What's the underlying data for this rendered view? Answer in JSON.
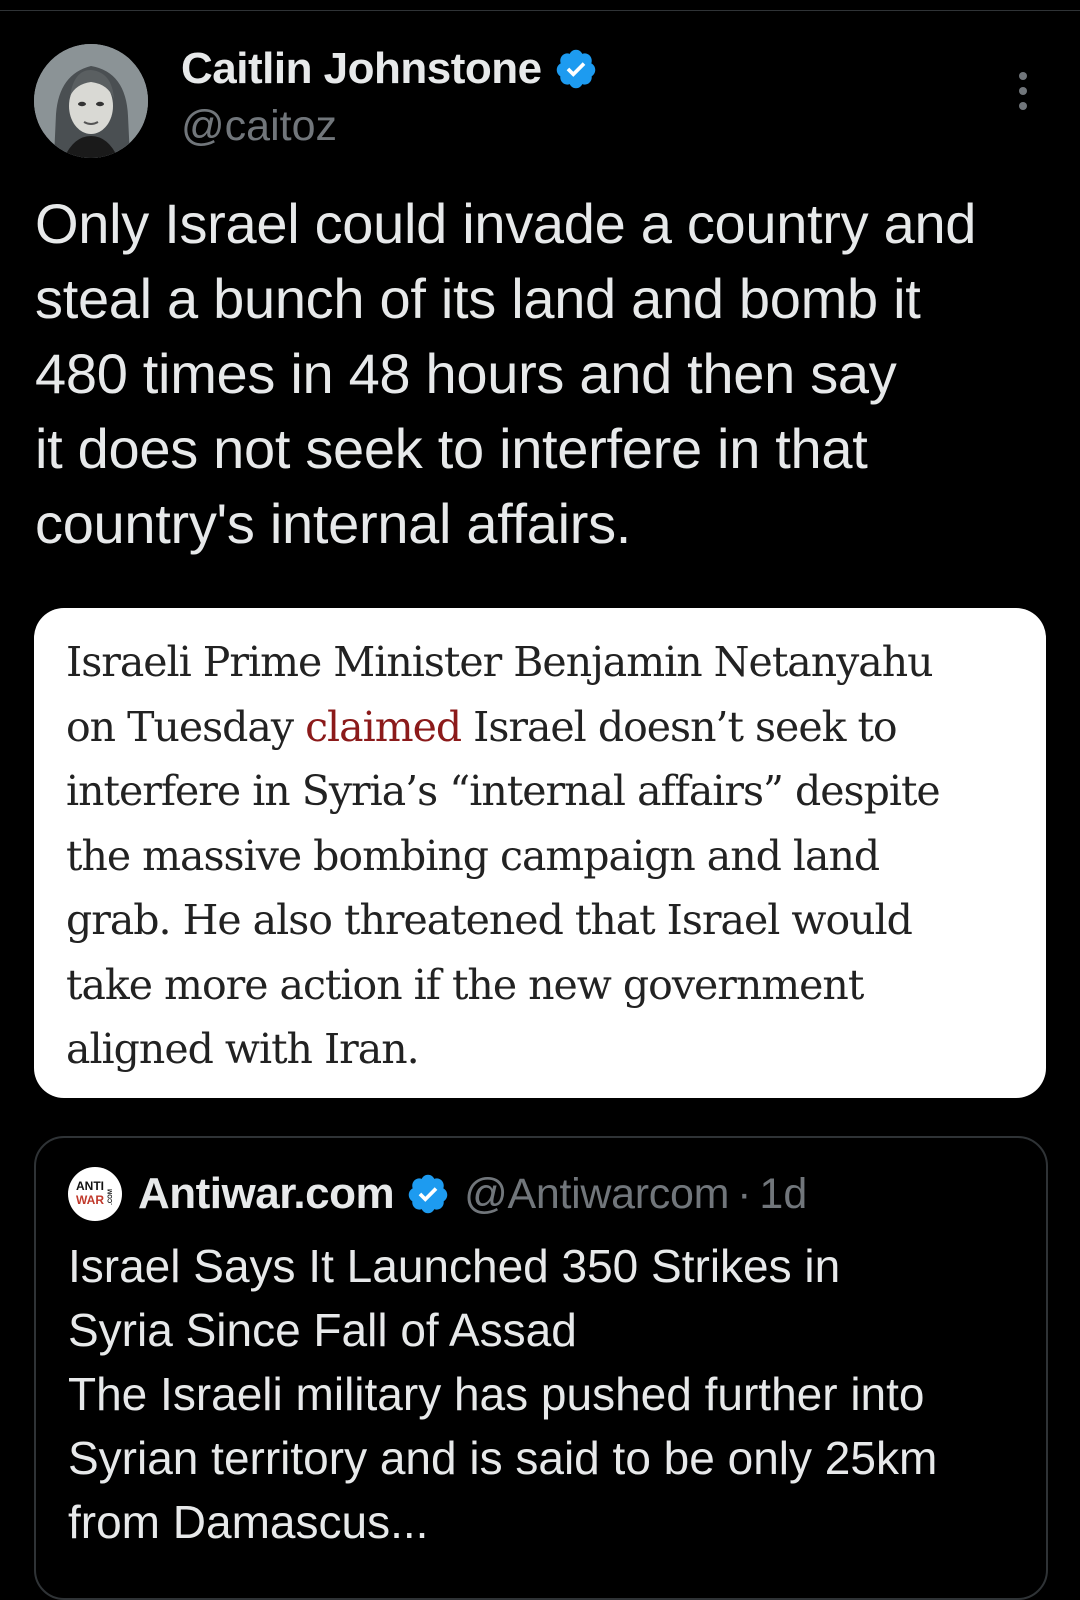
{
  "tweet": {
    "author": {
      "display_name": "Caitlin Johnstone",
      "handle": "@caitoz",
      "verified": true
    },
    "text_lines": [
      "Only Israel could invade a country and",
      "steal a bunch of its land and bomb it",
      "480 times in 48 hours and then say",
      "it does not seek to interfere in that",
      "country's internal affairs."
    ],
    "media": {
      "line1": "Israeli Prime Minister Benjamin Netanyahu",
      "line2_before": "on Tuesday ",
      "line2_link": "claimed",
      "line2_after": " Israel doesn’t seek to",
      "line3": "interfere in Syria’s “internal affairs” despite",
      "line4": "the massive bombing campaign and land",
      "line5": "grab. He also threatened that Israel would",
      "line6": "take more action if the new government",
      "line7": "aligned with Iran."
    }
  },
  "quoted_tweet": {
    "avatar_text_top": "ANTI",
    "avatar_text_bottom": "WAR",
    "avatar_text_side": ".COM",
    "display_name": "Antiwar.com",
    "handle": "@Antiwarcom",
    "separator": "·",
    "time": "1d",
    "text_lines": [
      "Israel Says It Launched 350 Strikes in",
      "Syria Since Fall of Assad",
      "The Israeli military has pushed further into",
      "Syrian territory and is said to be only 25km",
      "from Damascus..."
    ]
  },
  "colors": {
    "background": "#000000",
    "verified_blue": "#1d9bf0",
    "link_red": "#8b1a1a"
  },
  "icons": {
    "verified": "verified-badge-icon",
    "more": "more-options-icon"
  }
}
